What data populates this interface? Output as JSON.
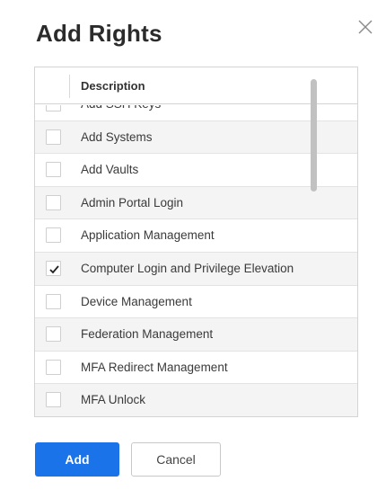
{
  "dialog": {
    "title": "Add Rights",
    "close_icon": "close-icon"
  },
  "grid": {
    "column_header": "Description",
    "rows": [
      {
        "label": "Add SSH Keys",
        "checked": false
      },
      {
        "label": "Add Systems",
        "checked": false
      },
      {
        "label": "Add Vaults",
        "checked": false
      },
      {
        "label": "Admin Portal Login",
        "checked": false
      },
      {
        "label": "Application Management",
        "checked": false
      },
      {
        "label": "Computer Login and Privilege Elevation",
        "checked": true
      },
      {
        "label": "Device Management",
        "checked": false
      },
      {
        "label": "Federation Management",
        "checked": false
      },
      {
        "label": "MFA Redirect Management",
        "checked": false
      },
      {
        "label": "MFA Unlock",
        "checked": false
      }
    ]
  },
  "footer": {
    "add_label": "Add",
    "cancel_label": "Cancel"
  },
  "colors": {
    "primary": "#1a73e8",
    "row_alt": "#f4f4f4",
    "border": "#d4d4d4"
  }
}
